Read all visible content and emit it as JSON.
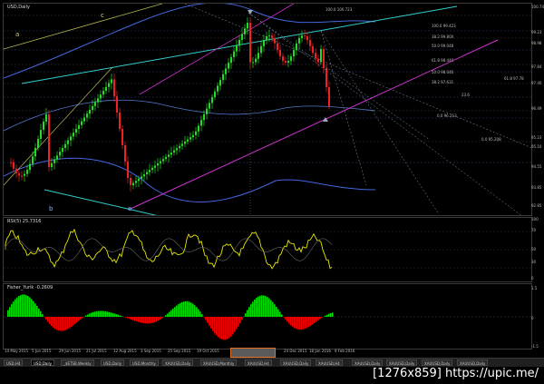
{
  "window": {
    "chart_title": "USD,Daily",
    "rsi_label": "RSI(5) 25.7316",
    "fisher_label": "Fisher_Yurik -0.2609"
  },
  "wave_labels": [
    {
      "text": "a",
      "color": "#d4d48a"
    },
    {
      "text": "c",
      "color": "#d4d48a"
    },
    {
      "text": "b",
      "color": "#8ab4ff"
    },
    {
      "text": "e",
      "color": "#8ab4ff"
    }
  ],
  "price_axis": [
    "100.74",
    "99.23",
    "98.98",
    "97.84",
    "97.40",
    "96.49",
    "95.10",
    "95.23",
    "94.55",
    "93.85",
    "92.85"
  ],
  "fib_levels": [
    {
      "text": "100.0  100.723"
    },
    {
      "text": "100.0  99.423"
    },
    {
      "text": "38.2  99.800"
    },
    {
      "text": "50.0  99.048"
    },
    {
      "text": "61.8  98.440"
    },
    {
      "text": "50.0  98.046"
    },
    {
      "text": "38.2  97.631"
    },
    {
      "text": "23.6"
    },
    {
      "text": "0.0  96.213"
    },
    {
      "text": "0.0  95.208"
    },
    {
      "text": "61.8  97.78"
    }
  ],
  "rsi_axis": [
    "100",
    "70",
    "50",
    "30",
    "0"
  ],
  "fisher_axis": [
    "1.5",
    "0",
    "-1.5"
  ],
  "time_axis": [
    "14 May 2015",
    "5 Jun 2015",
    "29 Jun 2015",
    "21 Jul 2015",
    "12 Aug 2015",
    "3 Sep 2015",
    "25 Sep 2015",
    "19 Oct 2015",
    "24 Dec 2015",
    "18 Jan 2016",
    "9 Feb 2016"
  ],
  "time_highlight": "",
  "tabs": [
    {
      "label": "USD,H4",
      "active": false
    },
    {
      "label": "USD,Daily",
      "active": true
    },
    {
      "label": "_$ETSB,Weekly",
      "active": false
    },
    {
      "label": "USD,Daily",
      "active": false
    },
    {
      "label": "USD,Monthly",
      "active": false
    },
    {
      "label": "XAUUSD,Daily",
      "active": false
    },
    {
      "label": "XAUUSD,Monthly",
      "active": false
    },
    {
      "label": "XAUUSD,H4",
      "active": false
    },
    {
      "label": "XAUUSD,Daily",
      "active": false
    },
    {
      "label": "XAUUSD,H4",
      "active": false
    },
    {
      "label": "XAUUSD,Daily",
      "active": false
    },
    {
      "label": "XAUUSD,Daily",
      "active": false
    },
    {
      "label": "XAUUSD,Daily",
      "active": false
    },
    {
      "label": "XAUUSD,Daily",
      "active": false
    }
  ],
  "watermark": "[1276x859] https://upic.me/",
  "colors": {
    "up_candle": "#22dd22",
    "down_candle": "#ee2222",
    "rsi": "#e8e800",
    "fisher_up": "#00dd00",
    "fisher_down": "#ee0000",
    "channel": "#33cccc",
    "magenta": "#cc33cc",
    "band": "#4466dd"
  }
}
